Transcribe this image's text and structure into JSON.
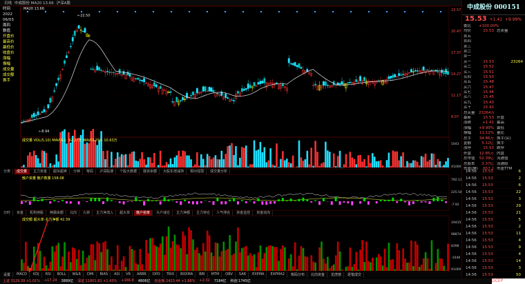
{
  "topbar": {
    "items": [
      "日线",
      "中成股份 MA20 13.66",
      "",
      "",
      "",
      "",
      "",
      "",
      "",
      "",
      "",
      "",
      "",
      "",
      "",
      "",
      "",
      "",
      "",
      "",
      "",
      "",
      "",
      "",
      "",
      "",
      "",
      "",
      "",
      "",
      "",
      "",
      "沪深A股"
    ]
  },
  "left_info": [
    {
      "label": "时间",
      "value": ""
    },
    {
      "label": "2022",
      "value": ""
    },
    {
      "label": "06/03",
      "value": ""
    },
    {
      "label": "周四",
      "value": ""
    },
    {
      "label": "数值",
      "value": ""
    },
    {
      "label": "开盘价",
      "value": ""
    },
    {
      "label": "最高价",
      "value": ""
    },
    {
      "label": "最低价",
      "value": ""
    },
    {
      "label": "收盘价",
      "value": ""
    },
    {
      "label": "涨幅",
      "value": ""
    },
    {
      "label": "振幅",
      "value": ""
    },
    {
      "label": "成交量",
      "value": ""
    },
    {
      "label": "成交额",
      "value": ""
    },
    {
      "label": "换手",
      "value": ""
    }
  ],
  "main_chart": {
    "price_axis": [
      "23.57",
      "20.47",
      "17.37",
      "14.27",
      "11.17",
      "8.07"
    ],
    "high_label": "22.50",
    "low_label": "8.94",
    "ma_label": "MA20 13.66"
  },
  "ind1": {
    "title": "成交量  VOL(5,10)  MAVOL1: 92.27万  MAVOL250: 10.63万",
    "axis": [
      "1043",
      "",
      "",
      "X1000"
    ]
  },
  "tabs1": [
    "分类",
    "成交量",
    "主力资金",
    "超买超卖",
    "分钟",
    "筹码",
    "沪深股通",
    "个股大数据",
    "融资余额",
    "大股东增减持",
    "相对强弱",
    "成交量分析"
  ],
  "ind2": {
    "title": "散户资量  散户数量  158.08",
    "axis": [
      "792.13",
      "225.54",
      "-7.92"
    ]
  },
  "tabs2": [
    "分时",
    "资金",
    "机构持股",
    "两融余额",
    "北向",
    "九转",
    "主力净流入",
    "超大单",
    "散户抢筹",
    "大户减仓",
    "主力净额",
    "主力持仓",
    "人气排名",
    "资金监控",
    "资金动向"
  ],
  "ind3": {
    "title": "成交额  超大单-主力净额  42.39",
    "axis": [
      "194352",
      "98874",
      "8398",
      "-1048",
      "X1000"
    ]
  },
  "tabs3": [
    "设置",
    "MACD",
    "KDJ",
    "RSI",
    "BOLL",
    "W&R",
    "DMI",
    "BIAS",
    "ASI",
    "VR",
    "ARBR",
    "DPO",
    "TRIX",
    "BOXMA",
    "BBI",
    "MTM",
    "OBV",
    "SAR",
    "EXPMA",
    "EXPMA2",
    "筹码分布",
    "北向资金",
    "龙虎榜",
    "逐笔成交"
  ],
  "status": [
    "上证 3129.39 +1.01%",
    "+17.24",
    "3889亿",
    "深证 11801.82 +1.43%",
    "+166.8",
    "4806亿",
    "创业板 2423.44 +1.88%",
    "+2.32",
    "7184亿",
    "科创 1745亿"
  ],
  "right_panel": {
    "code": "中成股份 000151",
    "price": "15.53",
    "change": "+1.41",
    "pct": "+9.99%",
    "rows": [
      {
        "k": "委比",
        "v": "+100.00%",
        "k2": "",
        "v2": ""
      },
      {
        "k": "均价",
        "v": "15.53",
        "k2": "总卖量",
        "v2": ""
      },
      {
        "k": "卖五",
        "v": "",
        "k2": "",
        "v2": ""
      },
      {
        "k": "卖四",
        "v": "",
        "k2": "",
        "v2": ""
      },
      {
        "k": "卖三",
        "v": "",
        "k2": "",
        "v2": ""
      },
      {
        "k": "卖二",
        "v": "",
        "k2": "",
        "v2": ""
      },
      {
        "k": "卖一",
        "v": "",
        "k2": "",
        "v2": ""
      },
      {
        "k": "买一",
        "v": "15.53",
        "k2": "",
        "v2": "23264"
      },
      {
        "k": "买二",
        "v": "15.52",
        "k2": "",
        "v2": ""
      },
      {
        "k": "买三",
        "v": "15.51",
        "k2": "",
        "v2": ""
      },
      {
        "k": "买四",
        "v": "15.50",
        "k2": "",
        "v2": ""
      },
      {
        "k": "买五",
        "v": "15.48",
        "k2": "",
        "v2": ""
      },
      {
        "k": "买六",
        "v": "15.47",
        "k2": "",
        "v2": ""
      },
      {
        "k": "买七",
        "v": "15.46",
        "k2": "",
        "v2": ""
      },
      {
        "k": "买八",
        "v": "15.45",
        "k2": "",
        "v2": ""
      },
      {
        "k": "买九",
        "v": "15.43",
        "k2": "",
        "v2": ""
      },
      {
        "k": "买十",
        "v": "15.42",
        "k2": "",
        "v2": ""
      },
      {
        "k": "总买量",
        "v": "23264万",
        "k2": "",
        "v2": ""
      },
      {
        "k": "最新",
        "v": "15.53",
        "k2": "开盘",
        "v2": ""
      },
      {
        "k": "涨跌",
        "v": "+1.41",
        "k2": "最高",
        "v2": ""
      },
      {
        "k": "涨幅",
        "v": "+9.99%",
        "k2": "最低",
        "v2": ""
      },
      {
        "k": "振幅",
        "v": "11.12%",
        "k2": "量比",
        "v2": ""
      },
      {
        "k": "总手",
        "v": "34.86万",
        "k2": "换手(实)",
        "v2": ""
      },
      {
        "k": "金额",
        "v": "5.12亿",
        "k2": "换手",
        "v2": ""
      },
      {
        "k": "涨停",
        "v": "15.53",
        "k2": "跌停",
        "v2": ""
      },
      {
        "k": "外盘",
        "v": "12.85万",
        "k2": "内盘",
        "v2": ""
      },
      {
        "k": "总市值",
        "v": "52.39亿",
        "k2": "流通值",
        "v2": ""
      },
      {
        "k": "总股本",
        "v": "3.37亿",
        "k2": "流通股",
        "v2": ""
      },
      {
        "k": "市盈(静)",
        "v": "657.2",
        "k2": "市盈TTM",
        "v2": ""
      }
    ]
  },
  "ticks": [
    {
      "t": "14:56",
      "p": "15.53",
      "v": "6"
    },
    {
      "t": "14:56",
      "p": "15.53",
      "v": "2"
    },
    {
      "t": "14:56",
      "p": "15.53",
      "v": "6"
    },
    {
      "t": "14:56",
      "p": "15.53",
      "v": "22"
    },
    {
      "t": "14:56",
      "p": "15.53",
      "v": "3"
    },
    {
      "t": "14:56",
      "p": "15.53",
      "v": "29"
    },
    {
      "t": "14:56",
      "p": "15.53",
      "v": "21"
    },
    {
      "t": "14:56",
      "p": "15.53",
      "v": "5"
    },
    {
      "t": "14:56",
      "p": "15.53",
      "v": "2"
    },
    {
      "t": "14:56",
      "p": "15.53",
      "v": "11"
    },
    {
      "t": "14:56",
      "p": "15.53",
      "v": "4"
    },
    {
      "t": "14:56",
      "p": "15.53",
      "v": "9"
    },
    {
      "t": "14:56",
      "p": "15.53",
      "v": "4"
    },
    {
      "t": "14:56",
      "p": "15.53",
      "v": "14"
    },
    {
      "t": "14:56",
      "p": "15.53",
      "v": "3"
    },
    {
      "t": "14:56",
      "p": "15.53",
      "v": "50"
    }
  ],
  "ad": {
    "text": "DCEP"
  }
}
